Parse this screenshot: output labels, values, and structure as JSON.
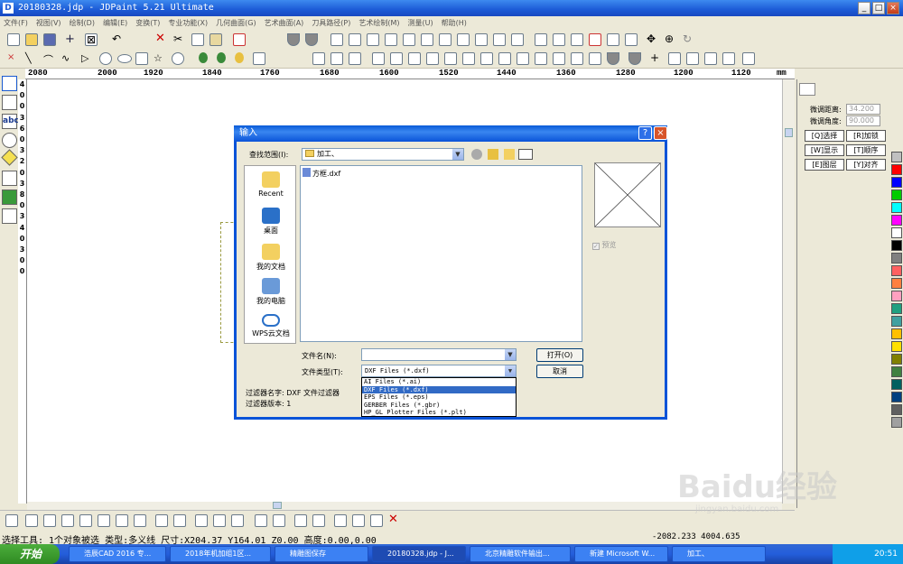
{
  "window": {
    "title": "20180328.jdp - JDPaint 5.21 Ultimate"
  },
  "menu": [
    "文件(F)",
    "视图(V)",
    "绘制(D)",
    "编辑(E)",
    "变换(T)",
    "专业功能(X)",
    "几何曲面(G)",
    "艺术曲面(A)",
    "刀具路径(P)",
    "艺术绘制(M)",
    "测量(U)",
    "帮助(H)"
  ],
  "ruler": {
    "ticks": [
      "2080",
      "2000",
      "1920",
      "1840",
      "1760",
      "1680",
      "1600",
      "1520",
      "1440",
      "1360",
      "1280",
      "1200",
      "1120"
    ],
    "unit": "mm",
    "vertical": [
      "4",
      "0",
      "0",
      "3",
      "6",
      "0",
      "3",
      "2",
      "0",
      "3",
      "8",
      "0",
      "3",
      "4",
      "0",
      "3",
      "0",
      "0"
    ]
  },
  "right_panel": {
    "label_distance": "微调距离:",
    "value_distance": "34.200",
    "label_angle": "微调角度:",
    "value_angle": "90.000",
    "buttons": [
      "[Q]选择",
      "[R]加锁",
      "[W]显示",
      "[T]顺序",
      "[E]图层",
      "[Y]对齐"
    ]
  },
  "palette": [
    "#c0c0c0",
    "#ff0000",
    "#0000ff",
    "#00cc00",
    "#00ffff",
    "#ff00ff",
    "#ffffff",
    "#000000",
    "#808080",
    "#ff6060",
    "#ff8040",
    "#ffa0c0",
    "#20a080",
    "#40a0a0",
    "#ffc000",
    "#ffe000",
    "#808000",
    "#408040",
    "#006060",
    "#004080",
    "#606060",
    "#a0a0a0"
  ],
  "dialog": {
    "title": "输入",
    "look_in_label": "查找范围(I):",
    "look_in_value": "加工、",
    "places": [
      "Recent",
      "桌面",
      "我的文档",
      "我的电脑",
      "WPS云文档"
    ],
    "files": [
      "方框.dxf"
    ],
    "preview_label": "预览",
    "filename_label": "文件名(N):",
    "filename_value": "",
    "filetype_label": "文件类型(T):",
    "filetype_value": "DXF Files (*.dxf)",
    "open_button": "打开(O)",
    "cancel_button": "取消",
    "filter_name": "过滤器名字: DXF 文件过滤器",
    "filter_version": "过滤器版本: 1",
    "filetype_options": [
      "AI Files (*.ai)",
      "DXF Files (*.dxf)",
      "EPS Files (*.eps)",
      "GERBER Files (*.gbr)",
      "HP_GL Plotter Files (*.plt)"
    ],
    "selected_option": 1
  },
  "status": {
    "left": "选择工具: 1个对象被选 类型:多义线 尺寸:X204.37 Y164.01 Z0.00 高度:0.00,0.00",
    "coords": "-2082.233  4004.635"
  },
  "taskbar": {
    "start": "开始",
    "tasks": [
      "浩辰CAD 2016 专...",
      "2018年机加组1区...",
      "精雕图保存",
      "20180328.jdp - J...",
      "北京精雕软件输出...",
      "新建 Microsoft W...",
      "加工、"
    ],
    "clock": "20:51"
  },
  "watermark": "Baidu经验",
  "watermark_sub": "jingyan.baidu.com"
}
